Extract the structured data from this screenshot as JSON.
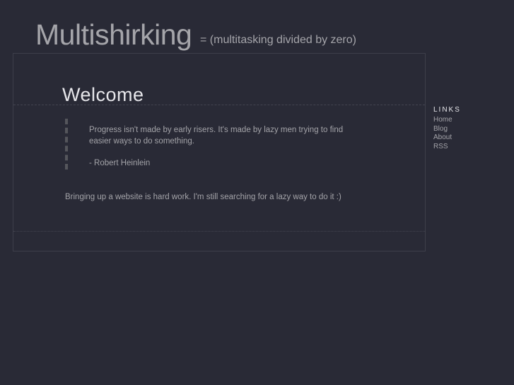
{
  "header": {
    "title": "Multishirking",
    "tagline": "= (multitasking divided by zero)"
  },
  "main": {
    "heading": "Welcome",
    "quote": {
      "text": "Progress isn't made by early risers. It's made by lazy men trying to find easier ways to do something.",
      "author": "- Robert Heinlein"
    },
    "paragraph": "Bringing up a website is hard work. I'm still searching for a lazy way to do it :)"
  },
  "sidebar": {
    "heading": "LINKS",
    "links": [
      {
        "label": "Home"
      },
      {
        "label": "Blog"
      },
      {
        "label": "About"
      },
      {
        "label": "RSS"
      }
    ]
  }
}
